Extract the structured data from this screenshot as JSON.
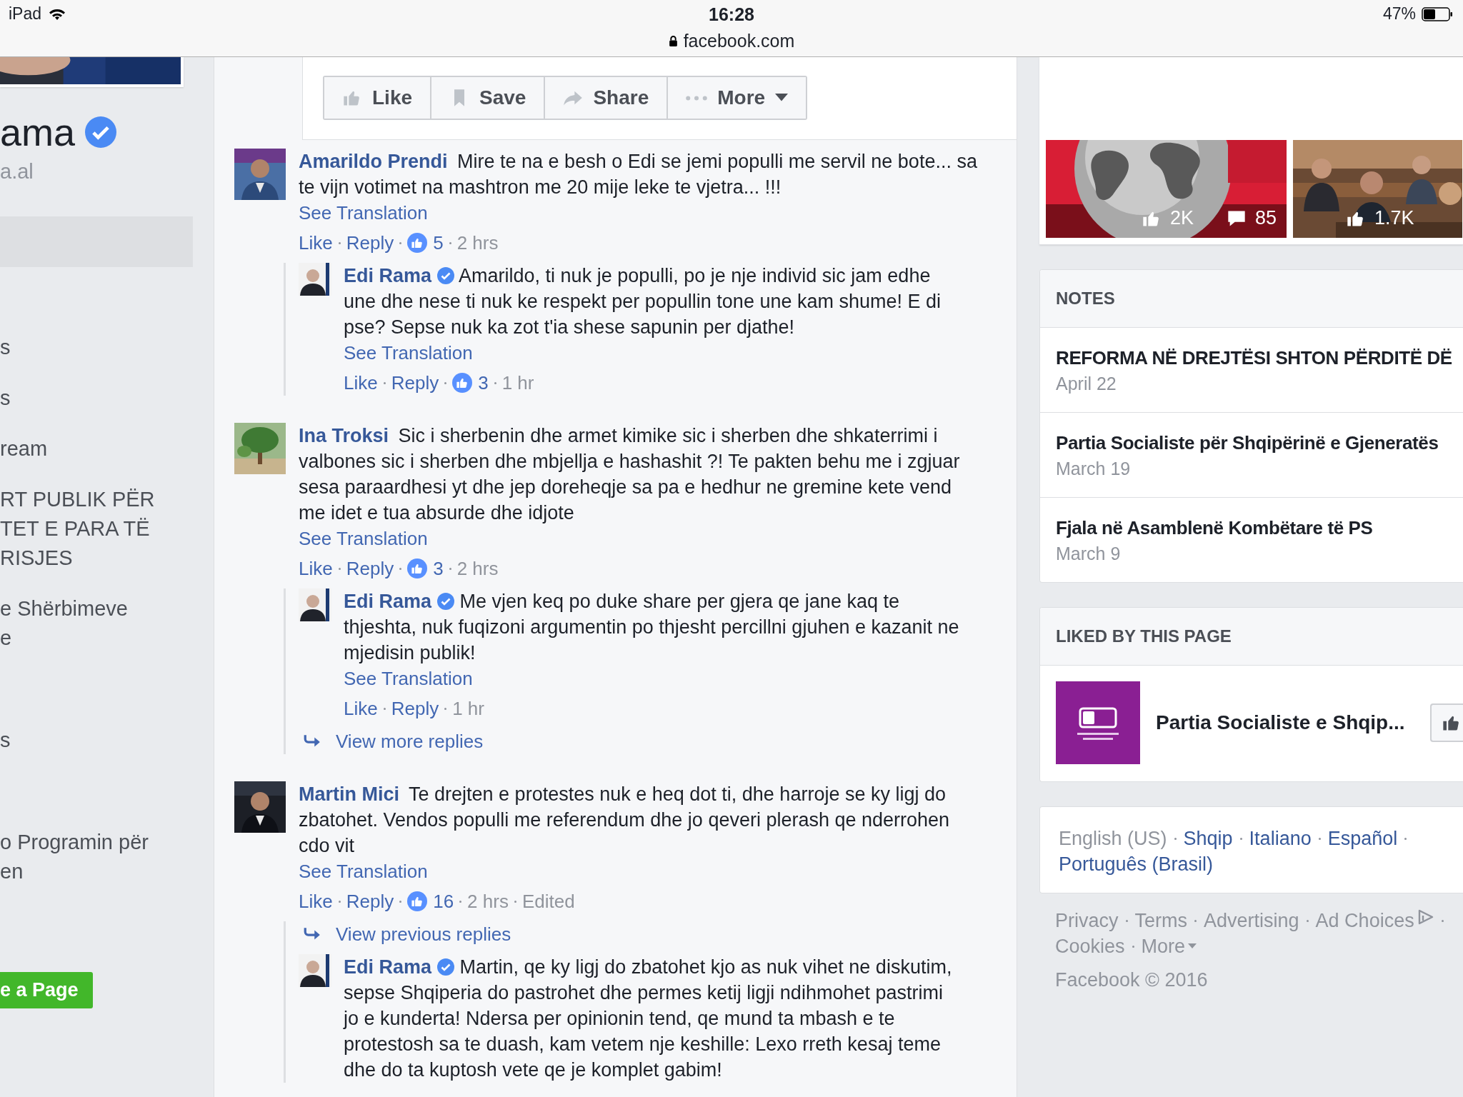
{
  "status_bar": {
    "device": "iPad",
    "time": "16:28",
    "url": "facebook.com",
    "battery": "47%"
  },
  "sidebar": {
    "title": "ama",
    "verified": true,
    "subtitle": "a.al",
    "items": [
      "s",
      "s",
      "ream",
      "RT PUBLIK PËR\nTET E PARA TË\nRISJES",
      "e Shërbimeve\ne",
      "s",
      "o Programin për\nen"
    ],
    "cta": "e a Page"
  },
  "post_actions": [
    {
      "kind": "like",
      "label": "Like"
    },
    {
      "kind": "save",
      "label": "Save"
    },
    {
      "kind": "share",
      "label": "Share"
    },
    {
      "kind": "more",
      "label": "More"
    }
  ],
  "comments": [
    {
      "author": "Amarildo Prendi",
      "verified": false,
      "text": "Mire te na e besh o Edi se jemi populli me servil ne bote... sa te vijn votimet na mashtron me 20 mije leke te vjetra... !!!",
      "translate": "See Translation",
      "like": "Like",
      "reply": "Reply",
      "reactions": "5",
      "time": "2 hrs",
      "replies": [
        {
          "author": "Edi Rama",
          "verified": true,
          "text": "Amarildo, ti nuk je populli, po je nje individ sic jam edhe une dhe nese ti nuk ke respekt per popullin tone une kam shume! E di pse? Sepse nuk ka zot t'ia shese sapunin per djathe!",
          "translate": "See Translation",
          "like": "Like",
          "reply": "Reply",
          "reactions": "3",
          "time": "1 hr"
        }
      ]
    },
    {
      "author": "Ina Troksi",
      "verified": false,
      "text": "Sic i sherbenin dhe armet kimike sic i sherben dhe shkaterrimi i valbones sic i sherben dhe mbjellja e hashashit ?! Te pakten behu me i zgjuar sesa paraardhesi yt dhe jep doreheqje sa pa e hedhur ne gremine kete vend me idet e tua absurde dhe idjote",
      "translate": "See Translation",
      "like": "Like",
      "reply": "Reply",
      "reactions": "3",
      "time": "2 hrs",
      "replies": [
        {
          "author": "Edi Rama",
          "verified": true,
          "text": "Me vjen keq po duke share per gjera qe jane kaq te thjeshta, nuk fuqizoni argumentin po thjesht percillni gjuhen e kazanit ne mjedisin publik!",
          "translate": "See Translation",
          "like": "Like",
          "reply": "Reply",
          "time": "1 hr"
        }
      ],
      "more_replies_link": "View more replies"
    },
    {
      "author": "Martin Mici",
      "verified": false,
      "text": "Te drejten e protestes nuk e heq dot ti, dhe harroje se ky ligj do zbatohet. Vendos populli me referendum dhe jo qeveri plerash qe nderrohen cdo vit",
      "translate": "See Translation",
      "like": "Like",
      "reply": "Reply",
      "reactions": "16",
      "time": "2 hrs",
      "edited": "Edited",
      "previous_replies_link": "View previous replies",
      "replies": [
        {
          "author": "Edi Rama",
          "verified": true,
          "text": "Martin, qe ky ligj do zbatohet kjo as nuk vihet ne diskutim, sepse Shqiperia do pastrohet dhe permes ketij ligji ndihmohet pastrimi jo e kunderta! Ndersa per opinionin tend, qe mund ta mbash e te protestosh sa te duash, kam vetem nje keshille: Lexo rreth kesaj teme dhe do ta kuptosh vete qe je komplet gabim!"
        }
      ]
    }
  ],
  "photos": [
    {
      "kind": "picture",
      "likes": "2K",
      "comments": "85"
    },
    {
      "kind": "picture",
      "likes": "1.7K"
    }
  ],
  "notes": {
    "title": "NOTES",
    "items": [
      {
        "title": "REFORMA NË DREJTËSI SHTON PËRDITË DË",
        "date": "April 22"
      },
      {
        "title": "Partia Socialiste për Shqipërinë e Gjeneratës",
        "date": "March 19"
      },
      {
        "title": "Fjala në Asamblenë Kombëtare të PS",
        "date": "March 9"
      }
    ]
  },
  "liked_by": {
    "title": "LIKED BY THIS PAGE",
    "pages": [
      {
        "name": "Partia Socialiste e Shqip..."
      }
    ]
  },
  "languages": {
    "current": "English (US)",
    "others": [
      "Shqip",
      "Italiano",
      "Español",
      "Português (Brasil)"
    ]
  },
  "footer": {
    "links": [
      "Privacy",
      "Terms",
      "Advertising",
      "Ad Choices",
      "Cookies",
      "More"
    ],
    "copyright": "Facebook © 2016"
  }
}
